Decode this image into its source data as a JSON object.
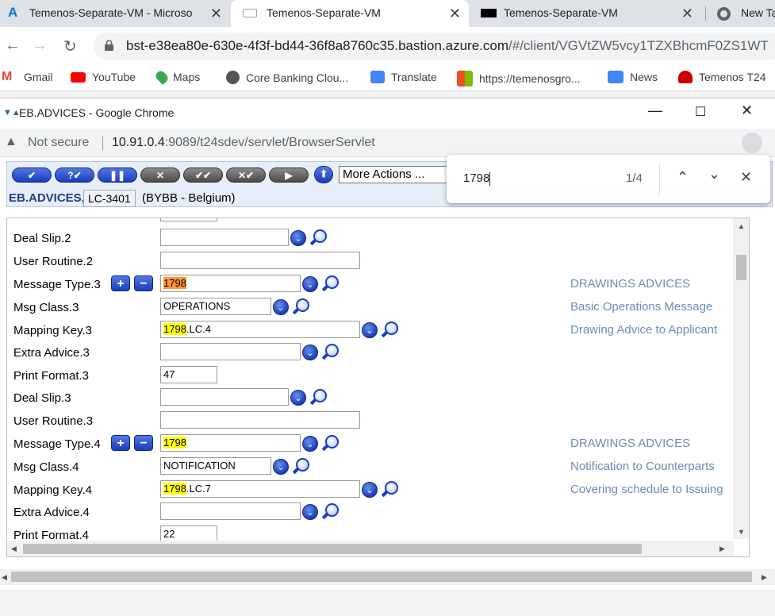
{
  "tabs": [
    {
      "title": "Temenos-Separate-VM - Microso"
    },
    {
      "title": "Temenos-Separate-VM"
    },
    {
      "title": "Temenos-Separate-VM"
    },
    {
      "title": "New Ta"
    }
  ],
  "address_bar": {
    "url_host": "bst-e38ea80e-630e-4f3f-bd44-36f8a8760c35.bastion.azure.com",
    "url_path": "/#/client/VGVtZW5vcy1TZXBhcmF0ZS1WT"
  },
  "bookmarks": [
    {
      "label": "Gmail",
      "color": "#ea4335"
    },
    {
      "label": "YouTube",
      "color": "#ff0000"
    },
    {
      "label": "Maps",
      "color": "#34a853"
    },
    {
      "label": "Core Banking Clou...",
      "color": "#555555"
    },
    {
      "label": "Translate",
      "color": "#4285f4"
    },
    {
      "label": "https://temenosgro...",
      "color": "#f25022"
    },
    {
      "label": "News",
      "color": "#4285f4"
    },
    {
      "label": "Temenos T24",
      "color": "#cc0000"
    }
  ],
  "popup": {
    "title": "EB.ADVICES - Google Chrome",
    "not_secure": "Not secure",
    "url_host": "10.91.0.4",
    "url_rest": ":9089/t24sdev/servlet/BrowserServlet"
  },
  "t24": {
    "more_actions": "More Actions ...",
    "app_name": "EB.ADVICES,",
    "company": "LC-3401",
    "region": "(BYBB - Belgium)"
  },
  "find": {
    "query": "1798",
    "count": "1/4"
  },
  "form": {
    "rows": [
      {
        "label": "Deal Slip.2",
        "value": "",
        "desc": ""
      },
      {
        "label": "User Routine.2",
        "value": "",
        "desc": ""
      },
      {
        "label": "Message Type.3",
        "value_hl": "1798",
        "desc": "DRAWINGS ADVICES"
      },
      {
        "label": "Msg Class.3",
        "value": "OPERATIONS",
        "desc": "Basic Operations Message"
      },
      {
        "label": "Mapping Key.3",
        "value_hl": "1798",
        "value_rest": ".LC.4",
        "desc": "Drawing Advice to Applicant"
      },
      {
        "label": "Extra Advice.3",
        "value": "",
        "desc": ""
      },
      {
        "label": "Print Format.3",
        "value": "47",
        "desc": ""
      },
      {
        "label": "Deal Slip.3",
        "value": "",
        "desc": ""
      },
      {
        "label": "User Routine.3",
        "value": "",
        "desc": ""
      },
      {
        "label": "Message Type.4",
        "value_hl": "1798",
        "desc": "DRAWINGS ADVICES"
      },
      {
        "label": "Msg Class.4",
        "value": "NOTIFICATION",
        "desc": "Notification to Counterparts"
      },
      {
        "label": "Mapping Key.4",
        "value_hl": "1798",
        "value_rest": ".LC.7",
        "desc": "Covering schedule to Issuing"
      },
      {
        "label": "Extra Advice.4",
        "value": "",
        "desc": ""
      },
      {
        "label": "Print Format.4",
        "value": "22",
        "desc": ""
      }
    ]
  }
}
